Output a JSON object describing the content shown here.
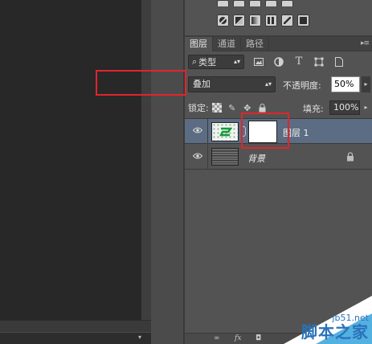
{
  "layers_panel": {
    "tabs": [
      {
        "label": "图层",
        "active": true
      },
      {
        "label": "通道",
        "active": false
      },
      {
        "label": "路径",
        "active": false
      }
    ],
    "filter": {
      "label": "类型"
    },
    "blend_mode": "叠加",
    "opacity_label": "不透明度:",
    "opacity_value": "50%",
    "lock_label": "锁定:",
    "fill_label": "填充:",
    "fill_value": "100%",
    "layers": [
      {
        "name": "图层 1",
        "selected": true,
        "visible": true
      },
      {
        "name": "背景",
        "selected": false,
        "visible": true,
        "locked": true
      }
    ]
  },
  "icons": {
    "visibility": "eye-icon",
    "filter": [
      "image-filter-icon",
      "adjustment-filter-icon",
      "text-filter-icon",
      "shape-filter-icon",
      "smart-object-filter-icon"
    ],
    "lock": [
      "lock-transparent-pixels-icon",
      "lock-image-pixels-icon",
      "lock-position-icon",
      "lock-all-icon"
    ]
  },
  "colors": {
    "selected_layer": "#5c6c82",
    "highlight_box": "#e0252b",
    "panel_bg": "#535353"
  },
  "watermark": {
    "url": "jb51.net",
    "name": "脚本之家"
  }
}
